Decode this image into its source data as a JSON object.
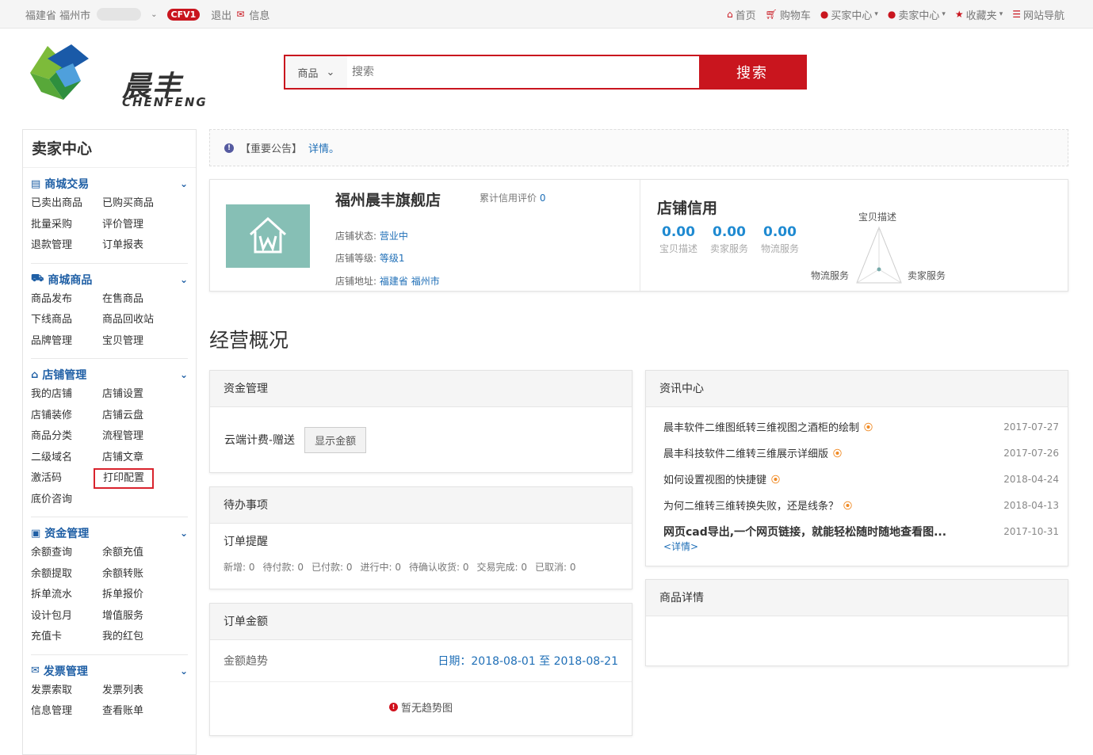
{
  "topbar": {
    "location": "福建省 福州市",
    "badge": "CFV1",
    "logout": "退出",
    "messages": "信息",
    "nav": [
      "首页",
      "购物车",
      "买家中心",
      "卖家中心",
      "收藏夹",
      "网站导航"
    ]
  },
  "logo": {
    "cn": "晨丰",
    "en": "CHENFENG"
  },
  "search": {
    "category": "商品",
    "placeholder": "搜索",
    "button": "搜索"
  },
  "sidebar": {
    "title": "卖家中心",
    "sections": [
      {
        "title": "商城交易",
        "icon": "list-icon",
        "items": [
          "已卖出商品",
          "已购买商品",
          "批量采购",
          "评价管理",
          "退款管理",
          "订单报表"
        ]
      },
      {
        "title": "商城商品",
        "icon": "truck-icon",
        "items": [
          "商品发布",
          "在售商品",
          "下线商品",
          "商品回收站",
          "品牌管理",
          "宝贝管理"
        ]
      },
      {
        "title": "店铺管理",
        "icon": "home-icon",
        "items": [
          "我的店铺",
          "店铺设置",
          "店铺装修",
          "店铺云盘",
          "商品分类",
          "流程管理",
          "二级域名",
          "店铺文章",
          "激活码",
          "打印配置",
          "底价咨询"
        ]
      },
      {
        "title": "资金管理",
        "icon": "money-icon",
        "items": [
          "余额查询",
          "余额充值",
          "余额提取",
          "余额转账",
          "拆单流水",
          "拆单报价",
          "设计包月",
          "增值服务",
          "充值卡",
          "我的红包"
        ]
      },
      {
        "title": "发票管理",
        "icon": "envelope-icon",
        "items": [
          "发票索取",
          "发票列表",
          "信息管理",
          "查看账单"
        ]
      }
    ]
  },
  "notice": {
    "label": "【重要公告】",
    "link": "详情。"
  },
  "shop": {
    "name": "福州晨丰旗舰店",
    "credit_label": "累计信用评价",
    "credit_value": "0",
    "status_label": "店铺状态:",
    "status_value": "营业中",
    "level_label": "店铺等级:",
    "level_value": "等级1",
    "address_label": "店铺地址:",
    "address_value": "福建省 福州市"
  },
  "credit": {
    "title": "店铺信用",
    "scores": [
      {
        "value": "0.00",
        "label": "宝贝描述"
      },
      {
        "value": "0.00",
        "label": "卖家服务"
      },
      {
        "value": "0.00",
        "label": "物流服务"
      }
    ],
    "radar_labels": {
      "top": "宝贝描述",
      "left": "物流服务",
      "right": "卖家服务"
    }
  },
  "overview": {
    "title": "经营概况"
  },
  "fund_panel": {
    "title": "资金管理",
    "label": "云端计费-赠送",
    "button": "显示金额"
  },
  "todo_panel": {
    "title": "待办事项",
    "subtitle": "订单提醒",
    "stats": [
      "新增: 0",
      "待付款: 0",
      "已付款: 0",
      "进行中: 0",
      "待确认收货: 0",
      "交易完成: 0",
      "已取消: 0"
    ]
  },
  "amount_panel": {
    "title": "订单金额",
    "trend_label": "金额趋势",
    "date": "日期：2018-08-01 至 2018-08-21",
    "empty": "暂无趋势图"
  },
  "news_panel": {
    "title": "资讯中心",
    "items": [
      {
        "title": "晨丰软件二维图纸转三维视图之酒柜的绘制",
        "date": "2017-07-27"
      },
      {
        "title": "晨丰科技软件二维转三维展示详细版",
        "date": "2017-07-26"
      },
      {
        "title": "如何设置视图的快捷键",
        "date": "2018-04-24"
      },
      {
        "title": "为何二维转三维转换失败，还是线条？",
        "date": "2018-04-13"
      },
      {
        "title": "网页cad导出,一个网页链接，就能轻松随时随地查看图...",
        "date": "2017-10-31"
      }
    ],
    "more": "<详情>"
  },
  "goods_panel": {
    "title": "商品详情"
  },
  "colors": {
    "accent": "#c9151e",
    "link": "#1f6fb7",
    "score": "#1f8ad1"
  }
}
